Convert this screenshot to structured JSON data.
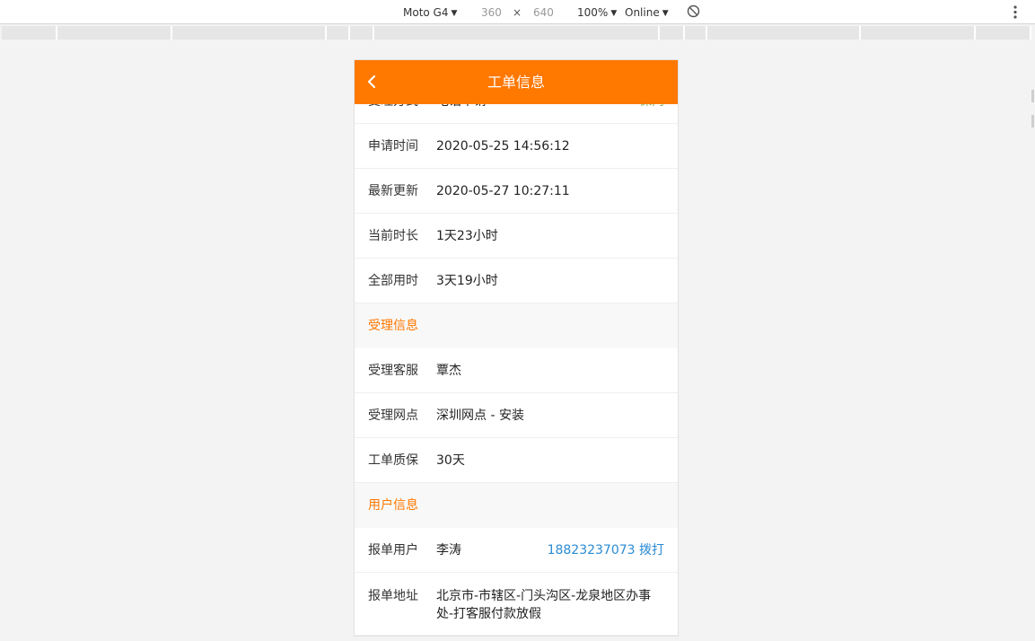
{
  "devtools": {
    "device": "Moto G4",
    "width": "360",
    "times": "×",
    "height": "640",
    "zoom": "100%",
    "network": "Online"
  },
  "header": {
    "title": "工单信息"
  },
  "rows": [
    {
      "label": "受理方式",
      "value": "电话申请",
      "right": "保内"
    },
    {
      "label": "申请时间",
      "value": "2020-05-25 14:56:12"
    },
    {
      "label": "最新更新",
      "value": "2020-05-27 10:27:11"
    },
    {
      "label": "当前时长",
      "value": "1天23小时"
    },
    {
      "label": "全部用时",
      "value": "3天19小时"
    }
  ],
  "sections": {
    "accept": "受理信息",
    "user": "用户信息"
  },
  "accept_rows": [
    {
      "label": "受理客服",
      "value": "覃杰"
    },
    {
      "label": "受理网点",
      "value": "深圳网点 - 安装"
    },
    {
      "label": "工单质保",
      "value": "30天"
    }
  ],
  "user_rows": [
    {
      "label": "报单用户",
      "value": "李涛",
      "phone": "18823237073 拨打"
    },
    {
      "label": "报单地址",
      "value": "北京市-市辖区-门头沟区-龙泉地区办事处-打客服付款放假"
    }
  ],
  "colors": {
    "accent": "#ff7800",
    "link": "#2a8bd3"
  }
}
